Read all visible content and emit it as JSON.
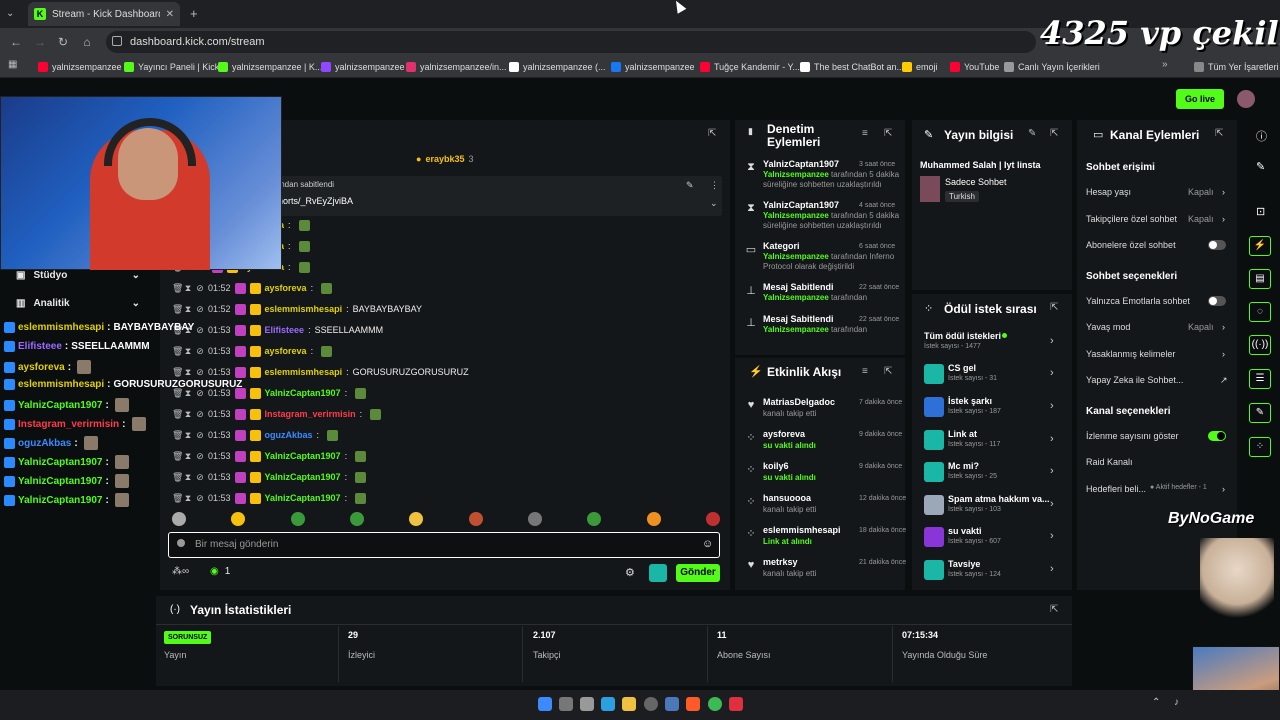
{
  "browser": {
    "tab_title": "Stream - Kick Dashboard",
    "tab_icon": "K",
    "url": "dashboard.kick.com/stream",
    "bookmarks": [
      {
        "label": "yalnizsempanzee",
        "color": "#ff0033"
      },
      {
        "label": "Yayıncı Paneli | Kick",
        "color": "#53fc18"
      },
      {
        "label": "yalnizsempanzee | K...",
        "color": "#53fc18"
      },
      {
        "label": "yalnizsempanzee",
        "color": "#9146ff"
      },
      {
        "label": "yalnizsempanzee/in...",
        "color": "#e1306c"
      },
      {
        "label": "yalnizsempanzee (...",
        "color": "#ffffff"
      },
      {
        "label": "yalnizsempanzee",
        "color": "#1877f2"
      },
      {
        "label": "Tuğçe Kandemir - Y...",
        "color": "#ff0033"
      },
      {
        "label": "The best ChatBot an...",
        "color": "#ffffff"
      },
      {
        "label": "emoji",
        "color": "#ffcc00"
      },
      {
        "label": "YouTube",
        "color": "#ff0033"
      },
      {
        "label": "Canlı Yayın İçerikleri",
        "color": "#999999"
      }
    ],
    "bookmarks_right": "Tüm Yer İşaretleri"
  },
  "header": {
    "go_live": "Go live"
  },
  "sidebar": {
    "studio": "Stüdyo",
    "analytics": "Analitik"
  },
  "overlay_text": {
    "promo": "4325 vp çekiliş",
    "brand": "ByNoGame"
  },
  "left_chat_overlay": [
    {
      "user": "eslemmismhesapi",
      "msg": "BAYBAYBAYBAY",
      "color": "#e0d000"
    },
    {
      "user": "Elifisteee",
      "msg": "SSEELLAAMMM",
      "color": "#9b6bff"
    },
    {
      "user": "aysforeva",
      "msg": "",
      "color": "#e0d000"
    },
    {
      "user": "eslemmismhesapi",
      "msg": "GORUSURUZGORUSURUZ",
      "color": "#e0d000"
    },
    {
      "user": "YalnizCaptan1907",
      "msg": "",
      "color": "#53fc18"
    },
    {
      "user": "Instagram_verirmisin",
      "msg": "",
      "color": "#ff3b4b"
    },
    {
      "user": "oguzAkbas",
      "msg": "",
      "color": "#3b8bff"
    },
    {
      "user": "YalnizCaptan1907",
      "msg": "",
      "color": "#53fc18"
    },
    {
      "user": "YalnizCaptan1907",
      "msg": "",
      "color": "#53fc18"
    },
    {
      "user": "YalnizCaptan1907",
      "msg": "",
      "color": "#53fc18"
    }
  ],
  "chat": {
    "top_user": "eraybk35",
    "top_count": "3",
    "pinned_label": "ından sabitlendi",
    "pinned_link": "horts/_RvEyZjviBA",
    "messages": [
      {
        "time": "",
        "user": "aysforeva",
        "msg": "",
        "color": "#e0d000"
      },
      {
        "time": "",
        "user": "aysforeva",
        "msg": "",
        "color": "#e0d000"
      },
      {
        "time": "",
        "user": "aysforeva",
        "msg": "",
        "color": "#e0d000"
      },
      {
        "time": "01:52",
        "user": "aysforeva",
        "msg": "",
        "color": "#e0d000"
      },
      {
        "time": "01:52",
        "user": "eslemmismhesapi",
        "msg": "BAYBAYBAYBAY",
        "color": "#e0d000"
      },
      {
        "time": "01:53",
        "user": "Elifisteee",
        "msg": "SSEELLAAMMM",
        "color": "#9b6bff"
      },
      {
        "time": "01:53",
        "user": "aysforeva",
        "msg": "",
        "color": "#e0d000"
      },
      {
        "time": "01:53",
        "user": "eslemmismhesapi",
        "msg": "GORUSURUZGORUSURUZ",
        "color": "#e0d000"
      },
      {
        "time": "01:53",
        "user": "YalnizCaptan1907",
        "msg": "",
        "color": "#53fc18"
      },
      {
        "time": "01:53",
        "user": "Instagram_verirmisin",
        "msg": "",
        "color": "#ff3b4b"
      },
      {
        "time": "01:53",
        "user": "oguzAkbas",
        "msg": "",
        "color": "#3b8bff"
      },
      {
        "time": "01:53",
        "user": "YalnizCaptan1907",
        "msg": "",
        "color": "#53fc18"
      },
      {
        "time": "01:53",
        "user": "YalnizCaptan1907",
        "msg": "",
        "color": "#53fc18"
      },
      {
        "time": "01:53",
        "user": "YalnizCaptan1907",
        "msg": "",
        "color": "#53fc18"
      }
    ],
    "input_placeholder": "Bir mesaj gönderin",
    "send": "Gönder",
    "viewers_count": "1"
  },
  "moderation": {
    "title": "Denetim Eylemleri",
    "items": [
      {
        "user": "YalnizCaptan1907",
        "actor": "Yalnizsempanzee",
        "detail": "tarafından 5 dakika süreliğine sohbetten uzaklaştırıldı",
        "when": "3 saat önce",
        "icon": "hourglass-icon"
      },
      {
        "user": "YalnizCaptan1907",
        "actor": "Yalnizsempanzee",
        "detail": "tarafından 5 dakika süreliğine sohbetten uzaklaştırıldı",
        "when": "4 saat önce",
        "icon": "hourglass-icon"
      },
      {
        "user": "Kategori",
        "actor": "Yalnizsempanzee",
        "detail": "tarafından Inferno Protocol olarak değiştirildi",
        "when": "6 saat önce",
        "icon": "category-icon"
      },
      {
        "user": "Mesaj Sabitlendi",
        "actor": "Yalnizsempanzee",
        "detail": "tarafından",
        "when": "22 saat önce",
        "icon": "pin-icon"
      },
      {
        "user": "Mesaj Sabitlendi",
        "actor": "Yalnizsempanzee",
        "detail": "tarafından",
        "when": "22 saat önce",
        "icon": "pin-icon"
      }
    ]
  },
  "activity": {
    "title": "Etkinlik Akışı",
    "items": [
      {
        "user": "MatriasDelgadoc",
        "detail": "kanalı takip etti",
        "when": "7 dakika önce",
        "green": false,
        "icon": "heart-icon"
      },
      {
        "user": "aysforeva",
        "detail": "su vakti alındı",
        "when": "9 dakika önce",
        "green": true,
        "icon": "share-icon"
      },
      {
        "user": "koily6",
        "detail": "su vakti alındı",
        "when": "9 dakika önce",
        "green": true,
        "icon": "share-icon"
      },
      {
        "user": "hansuoooa",
        "detail": "kanalı takip etti",
        "when": "12 dakika önce",
        "green": false,
        "icon": "share-icon"
      },
      {
        "user": "eslemmismhesapi",
        "detail": "Link at alındı",
        "when": "18 dakika önce",
        "green": true,
        "icon": "share-icon"
      },
      {
        "user": "metrksy",
        "detail": "kanalı takip etti",
        "when": "21 dakika önce",
        "green": false,
        "icon": "heart-icon"
      }
    ]
  },
  "stream_info": {
    "title": "Yayın bilgisi",
    "stream_title": "Muhammed Salah | Iyt linsta",
    "category": "Sadece Sohbet",
    "tag": "Turkish"
  },
  "rewards": {
    "title": "Ödül istek sırası",
    "all": "Tüm ödül istekleri",
    "all_count": "İstek sayısı - 1477",
    "items": [
      {
        "name": "CS gel",
        "count": "İstek sayısı - 31",
        "color": "#1ab6a6"
      },
      {
        "name": "İstek şarkı",
        "count": "İstek sayısı - 187",
        "color": "#2f6fd8"
      },
      {
        "name": "Link at",
        "count": "İstek sayısı - 117",
        "color": "#1ab6a6"
      },
      {
        "name": "Mc mi?",
        "count": "İstek sayısı - 25",
        "color": "#1ab6a6"
      },
      {
        "name": "Spam atma hakkım va...",
        "count": "İstek sayısı - 103",
        "color": "#9aa8b8"
      },
      {
        "name": "su vakti",
        "count": "İstek sayısı - 607",
        "color": "#8a35d8"
      },
      {
        "name": "Tavsiye",
        "count": "İstek sayısı - 124",
        "color": "#1ab6a6"
      }
    ]
  },
  "channel": {
    "title": "Kanal Eylemleri",
    "chat_access": "Sohbet erişimi",
    "account_age": "Hesap yaşı",
    "account_age_val": "Kapalı",
    "followers_only": "Takipçilere özel sohbet",
    "followers_only_val": "Kapalı",
    "subs_only": "Abonelere özel sohbet",
    "chat_options": "Sohbet seçenekleri",
    "emote_only": "Yalnızca Emotlarla sohbet",
    "slow_mode": "Yavaş mod",
    "slow_mode_val": "Kapalı",
    "banned_words": "Yasaklanmış kelimeler",
    "ai_chat": "Yapay Zeka ile Sohbet...",
    "channel_options": "Kanal seçenekleri",
    "show_viewers": "İzlenme sayısını göster",
    "raid": "Raid Kanalı",
    "goals": "Hedefleri beli...",
    "goals_val": "Aktif hedefler - 1"
  },
  "stats": {
    "title": "Yayın İstatistikleri",
    "status": "SORUNSUZ",
    "status_label": "Yayın",
    "viewers": "29",
    "viewers_label": "İzleyici",
    "followers": "2.107",
    "followers_label": "Takipçi",
    "subs": "11",
    "subs_label": "Abone Sayısı",
    "uptime": "07:15:34",
    "uptime_label": "Yayında Olduğu Süre"
  }
}
